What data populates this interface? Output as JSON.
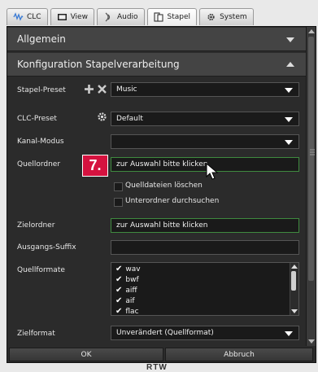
{
  "tabs": [
    {
      "label": "CLC",
      "icon": "clc-icon"
    },
    {
      "label": "View",
      "icon": "view-icon"
    },
    {
      "label": "Audio",
      "icon": "audio-icon"
    },
    {
      "label": "Stapel",
      "icon": "stapel-icon",
      "active": true
    },
    {
      "label": "System",
      "icon": "gear-icon"
    }
  ],
  "sections": {
    "general": {
      "title": "Allgemein"
    },
    "batch": {
      "title": "Konfiguration Stapelverarbeitung"
    }
  },
  "form": {
    "stapel_preset": {
      "label": "Stapel-Preset",
      "value": "Music"
    },
    "clc_preset": {
      "label": "CLC-Preset",
      "value": "Default"
    },
    "kanal_modus": {
      "label": "Kanal-Modus",
      "value": ""
    },
    "quellordner": {
      "label": "Quellordner",
      "value": "zur Auswahl bitte klicken"
    },
    "quelldateien_loeschen": {
      "label": "Quelldateien löschen",
      "checked": false
    },
    "unterordner": {
      "label": "Unterordner durchsuchen",
      "checked": false
    },
    "zielordner": {
      "label": "Zielordner",
      "value": "zur Auswahl bitte klicken"
    },
    "ausgangs_suffix": {
      "label": "Ausgangs-Suffix",
      "value": ""
    },
    "quellformate": {
      "label": "Quellformate",
      "items": [
        "wav",
        "bwf",
        "aiff",
        "aif",
        "flac"
      ]
    },
    "zielformat": {
      "label": "Zielformat",
      "value": "Unverändert (Quellformat)"
    }
  },
  "buttons": {
    "ok": "OK",
    "cancel": "Abbruch"
  },
  "callout": {
    "number": "7."
  },
  "brand": {
    "logo_text": "RTW"
  },
  "colors": {
    "panel_bg": "#2b2b2b",
    "section_bg": "#444444",
    "field_bg": "#1a1a1a",
    "selected_border": "#3f8a3f",
    "callout": "#d5123f"
  }
}
